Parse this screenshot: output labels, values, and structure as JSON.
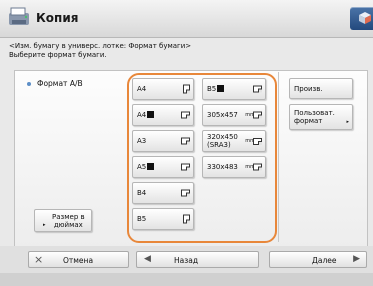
{
  "header": {
    "title": "Копия"
  },
  "instructions": {
    "line1": "<Изм. бумагу в универс. лотке: Формат бумаги>",
    "line2": "Выберите формат бумаги."
  },
  "left_panel": {
    "format_option": "Формат A/B",
    "size_inches_line1": "Размер в",
    "size_inches_line2": "дюймах"
  },
  "paper_sizes": {
    "a4": "A4",
    "a4r": "A4",
    "a3": "A3",
    "a5r": "A5",
    "b4": "B4",
    "b5": "B5",
    "b5r": "B5",
    "s305": "305x457",
    "s320_line1": "320x450",
    "s320_line2": "(SRA3)",
    "s330": "330x483",
    "mm": "mm"
  },
  "right_panel": {
    "custom": "Произв.",
    "user_format_line1": "Пользоват.",
    "user_format_line2": "формат"
  },
  "footer": {
    "cancel": "Отмена",
    "back": "Назад",
    "next": "Далее"
  },
  "colors": {
    "highlight": "#e8873a",
    "header_button": "#23497d"
  }
}
